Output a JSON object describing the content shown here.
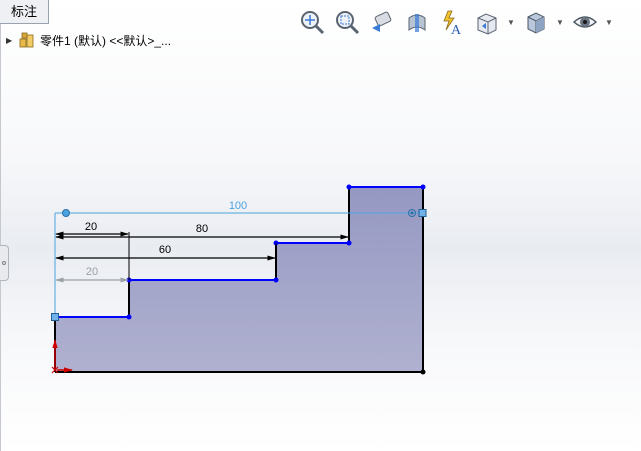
{
  "tab": {
    "label": "标注"
  },
  "tree": {
    "part_label": "零件1 (默认) <<默认>_..."
  },
  "toolbar": {
    "icons": [
      "zoom-to-fit-icon",
      "zoom-area-icon",
      "previous-view-icon",
      "section-view-icon",
      "dynamic-annotation-icon",
      "view-orientation-icon",
      "display-style-icon",
      "hide-show-items-icon"
    ]
  },
  "sketch": {
    "dimensions": [
      {
        "name": "overall-width",
        "value": "100"
      },
      {
        "name": "step-1",
        "value": "80"
      },
      {
        "name": "step-2",
        "value": "60"
      },
      {
        "name": "step-3-top",
        "value": "20"
      },
      {
        "name": "step-3-bottom",
        "value": "20"
      }
    ],
    "colors": {
      "fill": "#a3a5c8",
      "edge": "#0000ff",
      "fixed_edge": "#000000",
      "dim_active": "#000000",
      "dim_inactive": "#9aa0a6",
      "dim_selected": "#4da3e0",
      "origin": "#cc0000"
    }
  }
}
